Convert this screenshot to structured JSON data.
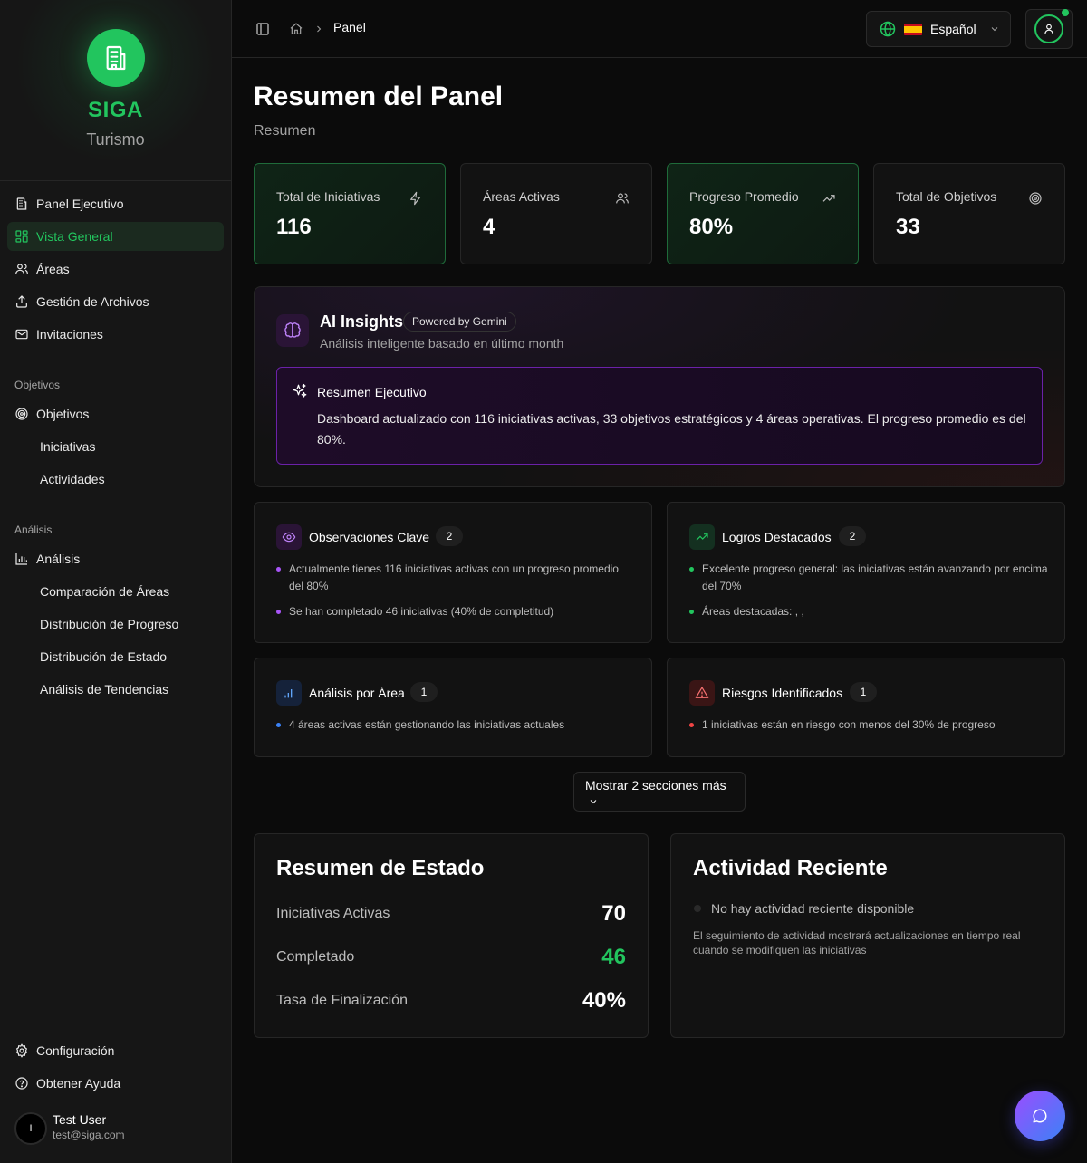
{
  "brand": {
    "name": "SIGA",
    "subtitle": "Turismo"
  },
  "sidebar": {
    "items": [
      {
        "label": "Panel Ejecutivo",
        "icon": "building-icon"
      },
      {
        "label": "Vista General",
        "icon": "grid-icon",
        "active": true
      },
      {
        "label": "Áreas",
        "icon": "users-icon"
      },
      {
        "label": "Gestión de Archivos",
        "icon": "upload-icon"
      },
      {
        "label": "Invitaciones",
        "icon": "mail-icon"
      }
    ],
    "objectives_group": "Objetivos",
    "objectives": {
      "label": "Objetivos",
      "icon": "target-icon"
    },
    "objectives_sub": [
      "Iniciativas",
      "Actividades"
    ],
    "analysis_group": "Análisis",
    "analysis": {
      "label": "Análisis",
      "icon": "bar-chart-icon"
    },
    "analysis_sub": [
      "Comparación de Áreas",
      "Distribución de Progreso",
      "Distribución de Estado",
      "Análisis de Tendencias"
    ],
    "settings": "Configuración",
    "help": "Obtener Ayuda"
  },
  "user": {
    "initial": "I",
    "name": "Test User",
    "email": "test@siga.com"
  },
  "header": {
    "breadcrumb": "Panel",
    "language": "Español"
  },
  "page": {
    "title": "Resumen del Panel",
    "subtitle": "Resumen"
  },
  "stats": [
    {
      "label": "Total de Iniciativas",
      "value": "116",
      "icon": "lightning-icon"
    },
    {
      "label": "Áreas Activas",
      "value": "4",
      "icon": "users-icon"
    },
    {
      "label": "Progreso Promedio",
      "value": "80%",
      "icon": "trending-up-icon"
    },
    {
      "label": "Total de Objetivos",
      "value": "33",
      "icon": "target-icon"
    }
  ],
  "ai": {
    "title": "AI Insights",
    "badge": "Powered by Gemini",
    "subtitle": "Análisis inteligente basado en último month",
    "summary_title": "Resumen Ejecutivo",
    "summary_text": "Dashboard actualizado con 116 iniciativas activas, 33 objetivos estratégicos y 4 áreas operativas. El progreso promedio es del 80%."
  },
  "insights": {
    "observations": {
      "title": "Observaciones Clave",
      "count": "2",
      "items": [
        "Actualmente tienes 116 iniciativas activas con un progreso promedio del 80%",
        "Se han completado 46 iniciativas (40% de completitud)"
      ]
    },
    "achievements": {
      "title": "Logros Destacados",
      "count": "2",
      "items": [
        "Excelente progreso general: las iniciativas están avanzando por encima del 70%",
        "Áreas destacadas: , ,"
      ]
    },
    "by_area": {
      "title": "Análisis por Área",
      "count": "1",
      "items": [
        "4 áreas activas están gestionando las iniciativas actuales"
      ]
    },
    "risks": {
      "title": "Riesgos Identificados",
      "count": "1",
      "items": [
        "1 iniciativas están en riesgo con menos del 30% de progreso"
      ]
    }
  },
  "show_more": "Mostrar 2 secciones más",
  "status_summary": {
    "title": "Resumen de Estado",
    "rows": [
      {
        "label": "Iniciativas Activas",
        "value": "70"
      },
      {
        "label": "Completado",
        "value": "46"
      },
      {
        "label": "Tasa de Finalización",
        "value": "40%"
      }
    ]
  },
  "recent": {
    "title": "Actividad Reciente",
    "empty": "No hay actividad reciente disponible",
    "empty_desc": "El seguimiento de actividad mostrará actualizaciones en tiempo real cuando se modifiquen las iniciativas"
  },
  "colors": {
    "accent": "#22c55e",
    "purple": "#a855f7",
    "blue": "#3b82f6",
    "red": "#ef4444"
  }
}
